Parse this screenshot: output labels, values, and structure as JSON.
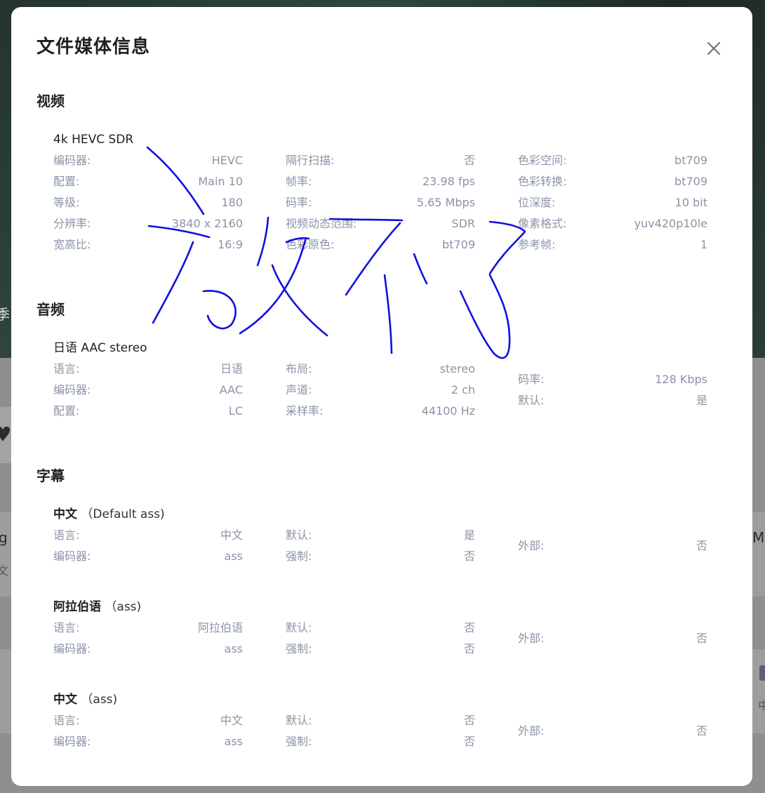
{
  "modal": {
    "title": "文件媒体信息"
  },
  "video": {
    "section_title": "视频",
    "stream_title": "4k HEVC SDR",
    "col1": [
      {
        "k": "编码器:",
        "v": "HEVC"
      },
      {
        "k": "配置:",
        "v": "Main 10"
      },
      {
        "k": "等级:",
        "v": "180"
      },
      {
        "k": "分辨率:",
        "v": "3840 x 2160"
      },
      {
        "k": "宽高比:",
        "v": "16:9"
      }
    ],
    "col2": [
      {
        "k": "隔行扫描:",
        "v": "否"
      },
      {
        "k": "帧率:",
        "v": "23.98 fps"
      },
      {
        "k": "码率:",
        "v": "5.65 Mbps"
      },
      {
        "k": "视频动态范围:",
        "v": "SDR"
      },
      {
        "k": "色彩原色:",
        "v": "bt709"
      }
    ],
    "col3": [
      {
        "k": "色彩空间:",
        "v": "bt709"
      },
      {
        "k": "色彩转换:",
        "v": "bt709"
      },
      {
        "k": "位深度:",
        "v": "10 bit"
      },
      {
        "k": "像素格式:",
        "v": "yuv420p10le"
      },
      {
        "k": "参考帧:",
        "v": "1"
      }
    ]
  },
  "audio": {
    "section_title": "音频",
    "stream_title": "日语 AAC stereo",
    "col1": [
      {
        "k": "语言:",
        "v": "日语"
      },
      {
        "k": "编码器:",
        "v": "AAC"
      },
      {
        "k": "配置:",
        "v": "LC"
      }
    ],
    "col2": [
      {
        "k": "布局:",
        "v": "stereo"
      },
      {
        "k": "声道:",
        "v": "2 ch"
      },
      {
        "k": "采样率:",
        "v": "44100 Hz"
      }
    ],
    "col3": [
      {
        "k": "码率:",
        "v": "128 Kbps"
      },
      {
        "k": "默认:",
        "v": "是"
      }
    ]
  },
  "subtitles": {
    "section_title": "字幕",
    "tracks": [
      {
        "name": "中文",
        "sub": "（Default ass)",
        "col1": [
          {
            "k": "语言:",
            "v": "中文"
          },
          {
            "k": "编码器:",
            "v": "ass"
          }
        ],
        "col2": [
          {
            "k": "默认:",
            "v": "是"
          },
          {
            "k": "强制:",
            "v": "否"
          }
        ],
        "col3": [
          {
            "k": "外部:",
            "v": "否"
          }
        ]
      },
      {
        "name": "阿拉伯语",
        "sub": "（ass)",
        "col1": [
          {
            "k": "语言:",
            "v": "阿拉伯语"
          },
          {
            "k": "编码器:",
            "v": "ass"
          }
        ],
        "col2": [
          {
            "k": "默认:",
            "v": "否"
          },
          {
            "k": "强制:",
            "v": "否"
          }
        ],
        "col3": [
          {
            "k": "外部:",
            "v": "否"
          }
        ]
      },
      {
        "name": "中文",
        "sub": "（ass)",
        "col1": [
          {
            "k": "语言:",
            "v": "中文"
          },
          {
            "k": "编码器:",
            "v": "ass"
          }
        ],
        "col2": [
          {
            "k": "默认:",
            "v": "否"
          },
          {
            "k": "强制:",
            "v": "否"
          }
        ],
        "col3": [
          {
            "k": "外部:",
            "v": "否"
          }
        ]
      }
    ]
  },
  "background": {
    "fragments": [
      "季",
      "g",
      "文",
      "Mu",
      "中"
    ]
  },
  "colors": {
    "scribble": "#1010e0",
    "label": "#8a94a6",
    "title": "#1f1f1f"
  },
  "icons": [
    "close-icon",
    "heart-icon"
  ]
}
